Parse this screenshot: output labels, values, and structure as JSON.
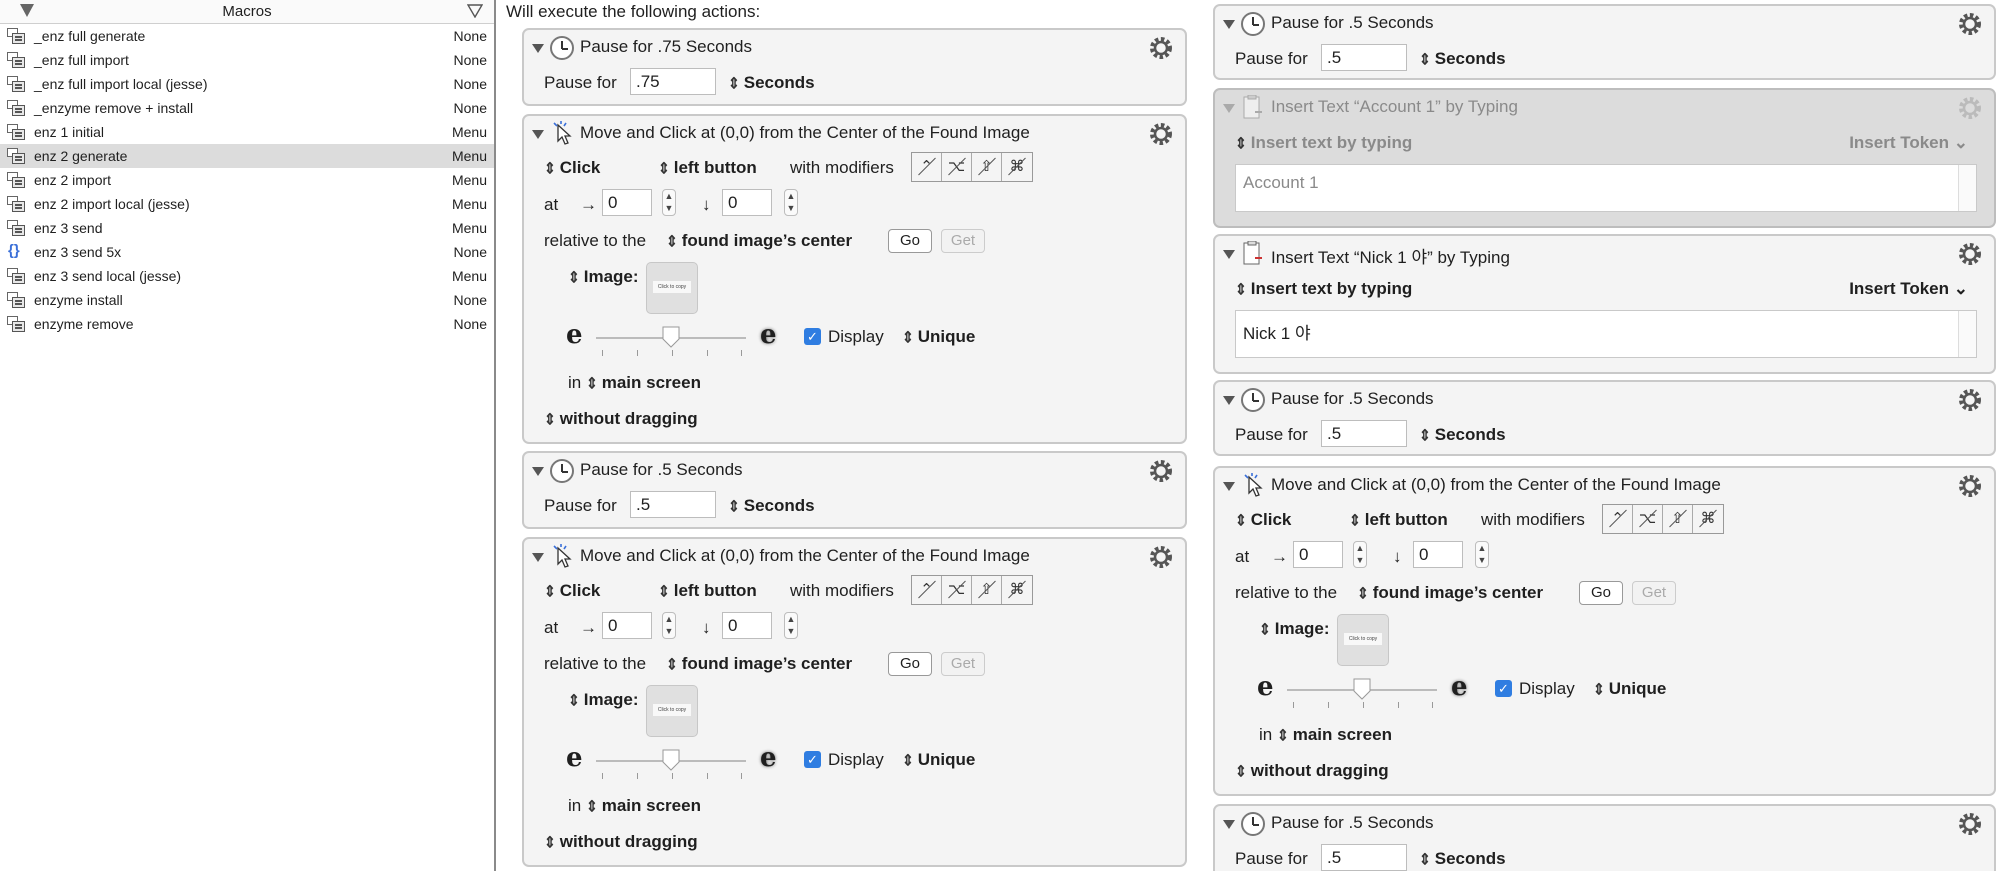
{
  "sidebar": {
    "title": "Macros",
    "items": [
      {
        "name": "_enz full generate",
        "trigger": "None",
        "icon": "macro-icon"
      },
      {
        "name": "_enz full import",
        "trigger": "None",
        "icon": "macro-icon"
      },
      {
        "name": "_enz full import local (jesse)",
        "trigger": "None",
        "icon": "macro-icon"
      },
      {
        "name": "_enzyme remove + install",
        "trigger": "None",
        "icon": "macro-icon"
      },
      {
        "name": "enz 1 initial",
        "trigger": "Menu",
        "icon": "macro-icon"
      },
      {
        "name": "enz 2 generate",
        "trigger": "Menu",
        "icon": "macro-icon"
      },
      {
        "name": "enz 2 import",
        "trigger": "Menu",
        "icon": "macro-icon"
      },
      {
        "name": "enz 2 import local (jesse)",
        "trigger": "Menu",
        "icon": "macro-icon"
      },
      {
        "name": "enz 3 send",
        "trigger": "Menu",
        "icon": "macro-icon"
      },
      {
        "name": "enz 3 send 5x",
        "trigger": "None",
        "icon": "braces-icon"
      },
      {
        "name": "enz 3 send local (jesse)",
        "trigger": "Menu",
        "icon": "macro-icon"
      },
      {
        "name": "enzyme install",
        "trigger": "None",
        "icon": "macro-icon"
      },
      {
        "name": "enzyme remove",
        "trigger": "None",
        "icon": "macro-icon"
      }
    ],
    "selected_index": 5
  },
  "main": {
    "heading": "Will execute the following actions:",
    "common": {
      "pause_for": "Pause for",
      "seconds": "Seconds",
      "click": "Click",
      "left_button": "left button",
      "with_modifiers": "with modifiers",
      "at": "at",
      "arrow_right": "→",
      "arrow_down": "↓",
      "relative_to": "relative to the",
      "found_center": "found image’s center",
      "go": "Go",
      "get": "Get",
      "image": "Image:",
      "display": "Display",
      "unique": "Unique",
      "in": "in",
      "main_screen": "main screen",
      "without_dragging": "without dragging",
      "insert_by_typing": "Insert text by typing",
      "insert_token": "Insert Token",
      "e": "e",
      "modifier_symbols": [
        "⌃",
        "⌥",
        "⇧",
        "⌘"
      ],
      "thumb_text": "Click to copy"
    },
    "left": {
      "pause1": {
        "title": "Pause for .75 Seconds",
        "value": ".75"
      },
      "click1": {
        "title": "Move and Click at (0,0) from the Center of the Found Image",
        "x": "0",
        "y": "0"
      },
      "pause2": {
        "title": "Pause for .5 Seconds",
        "value": ".5"
      },
      "click2": {
        "title": "Move and Click at (0,0) from the Center of the Found Image",
        "x": "0",
        "y": "0"
      }
    },
    "right": {
      "pause1": {
        "title": "Pause for .5 Seconds",
        "value": ".5"
      },
      "insert1": {
        "title": "Insert Text “Account 1” by Typing",
        "text": "Account 1"
      },
      "insert2": {
        "title": "Insert Text “Nick 1 야” by Typing",
        "text": "Nick 1 야"
      },
      "pause2": {
        "title": "Pause for .5 Seconds",
        "value": ".5"
      },
      "click1": {
        "title": "Move and Click at (0,0) from the Center of the Found Image",
        "x": "0",
        "y": "0"
      },
      "pause3": {
        "title": "Pause for .5 Seconds",
        "value": ".5"
      }
    }
  }
}
